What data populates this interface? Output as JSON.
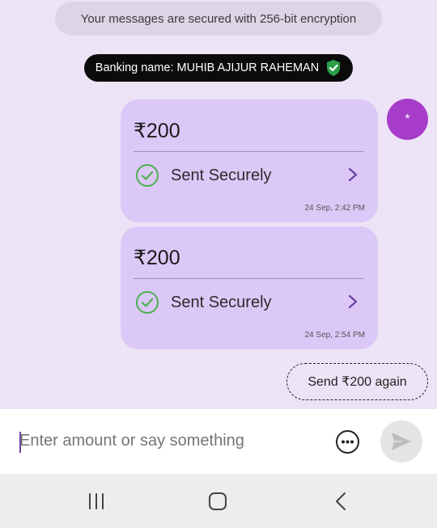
{
  "encryption_notice": "Your messages are secured with 256-bit encryption",
  "banking_name": "Banking name: MUHIB AJIJUR RAHEMAN",
  "avatar_initial": "*",
  "messages": [
    {
      "amount": "₹200",
      "status": "Sent Securely",
      "time": "24 Sep, 2:42 PM"
    },
    {
      "amount": "₹200",
      "status": "Sent Securely",
      "time": "24 Sep, 2:54 PM"
    }
  ],
  "send_again_label": "Send ₹200 again",
  "composer": {
    "placeholder": "Enter amount or say something"
  },
  "icons": {
    "shield": "verified-shield-icon",
    "status": "check-circle-icon",
    "chevron": "chevron-right-icon",
    "more": "more-options-icon",
    "send": "send-icon",
    "recents": "recent-apps-icon",
    "home": "home-icon",
    "back": "back-icon"
  },
  "colors": {
    "background": "#ECE4F6",
    "bubble": "#DCC8F7",
    "avatar": "#A63CC9",
    "verified": "#2E9E48",
    "success": "#4CAF50",
    "accent": "#6a3fa1"
  }
}
